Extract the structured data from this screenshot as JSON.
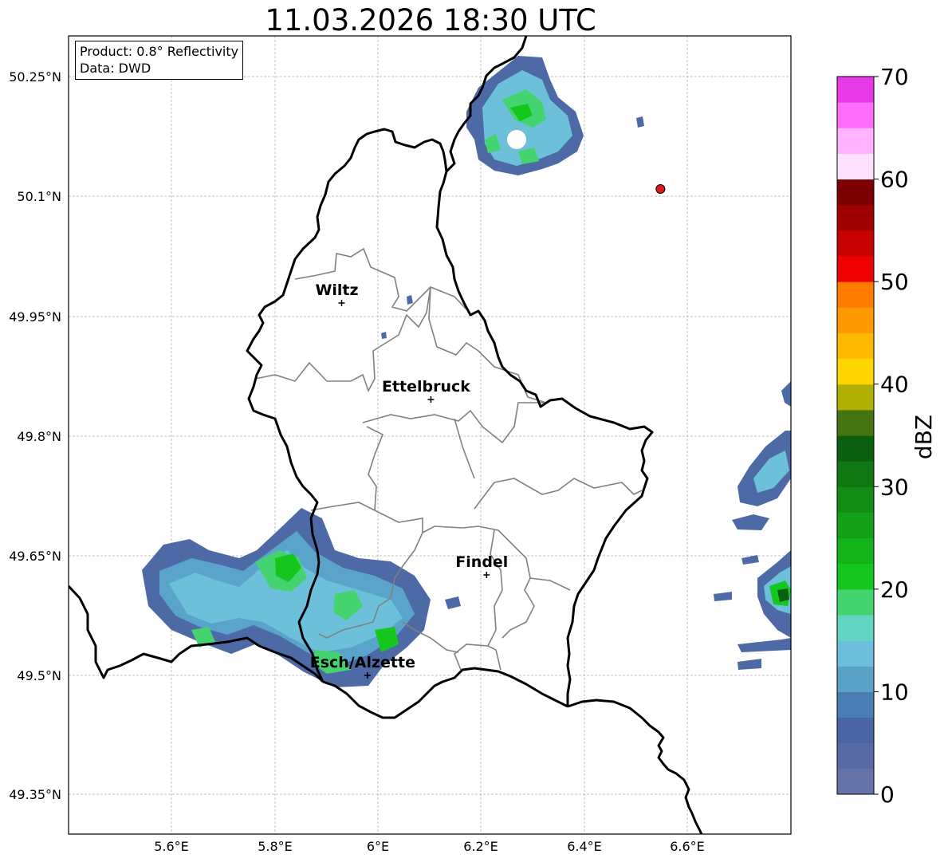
{
  "title": "11.03.2026 18:30 UTC",
  "info": {
    "product": "Product: 0.8° Reflectivity",
    "source": "Data: DWD"
  },
  "lat_ticks": [
    "50.25°N",
    "50.1°N",
    "49.95°N",
    "49.8°N",
    "49.65°N",
    "49.5°N",
    "49.35°N"
  ],
  "lon_ticks": [
    "5.6°E",
    "5.8°E",
    "6°E",
    "6.2°E",
    "6.4°E",
    "6.6°E"
  ],
  "cities": [
    {
      "name": "Wiltz",
      "lon": 5.93,
      "lat": 49.967
    },
    {
      "name": "Ettelbruck",
      "lon": 6.103,
      "lat": 49.846
    },
    {
      "name": "Findel",
      "lon": 6.211,
      "lat": 49.626
    },
    {
      "name": "Esch/Alzette",
      "lon": 5.98,
      "lat": 49.5
    }
  ],
  "radar_site": {
    "lon": 6.548,
    "lat": 50.11,
    "color": "#e31a1c"
  },
  "colorbar": {
    "label": "dBZ",
    "ticks": [
      "0",
      "10",
      "20",
      "30",
      "40",
      "50",
      "60",
      "70"
    ],
    "colors": [
      "#6472a8",
      "#576aa6",
      "#4766a3",
      "#497eb5",
      "#5ba2c9",
      "#6bbfda",
      "#62d5c2",
      "#44d46f",
      "#14c61d",
      "#15b31a",
      "#13a017",
      "#128c15",
      "#0f7812",
      "#0b5f0e",
      "#457510",
      "#b0b003",
      "#ffd700",
      "#ffba00",
      "#ff9900",
      "#ff7b00",
      "#ee0000",
      "#c70000",
      "#a00000",
      "#7c0000",
      "#fee1fe",
      "#ffb3ff",
      "#ff6dff",
      "#e839e8"
    ]
  }
}
